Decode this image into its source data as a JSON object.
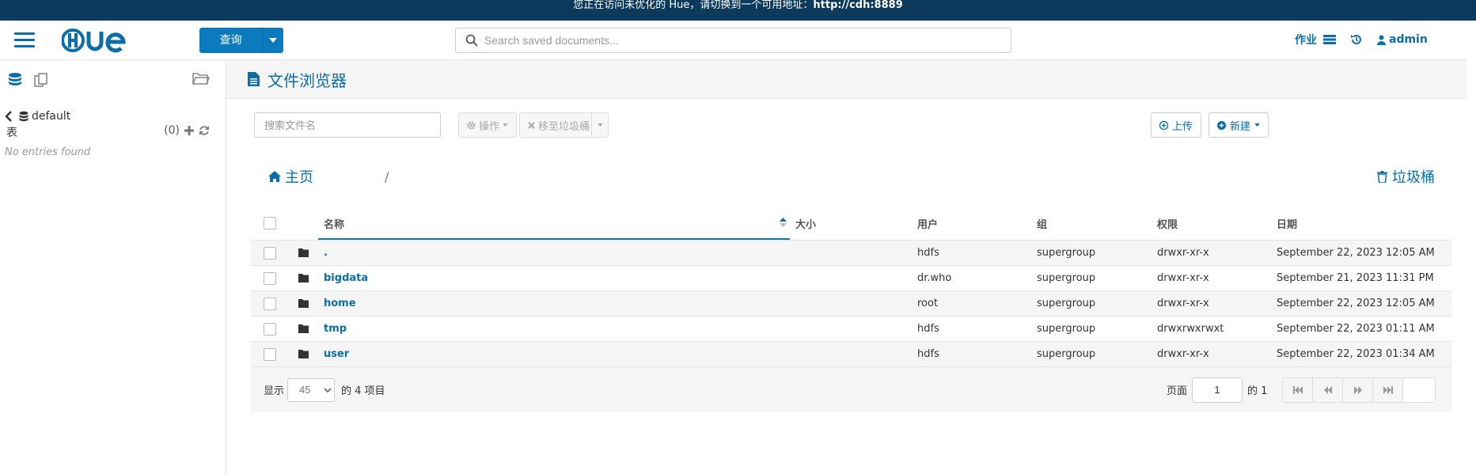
{
  "banner": {
    "text": "您正在访问未优化的 Hue，请切换到一个可用地址：",
    "link": "http://cdh:8889"
  },
  "topnav": {
    "logo": "Hue",
    "query_label": "查询",
    "search_placeholder": "Search saved documents...",
    "jobs_label": "作业",
    "user_label": "admin"
  },
  "sidebar": {
    "database": "default",
    "tables_label": "表",
    "tables_count": "(0)",
    "no_entries": "No entries found"
  },
  "main": {
    "title": "文件浏览器",
    "search_placeholder": "搜索文件名",
    "actions_label": "操作",
    "trash_move_label": "移至垃圾桶",
    "upload_label": "上传",
    "new_label": "新建",
    "breadcrumb_home": "主页",
    "breadcrumb_sep": "/",
    "trash_label": "垃圾桶"
  },
  "table": {
    "columns": [
      "名称",
      "大小",
      "用户",
      "组",
      "权限",
      "日期"
    ],
    "rows": [
      {
        "name": ".",
        "size": "",
        "user": "hdfs",
        "group": "supergroup",
        "perm": "drwxr-xr-x",
        "date": "September 22, 2023 12:05 AM"
      },
      {
        "name": "bigdata",
        "size": "",
        "user": "dr.who",
        "group": "supergroup",
        "perm": "drwxr-xr-x",
        "date": "September 21, 2023 11:31 PM"
      },
      {
        "name": "home",
        "size": "",
        "user": "root",
        "group": "supergroup",
        "perm": "drwxr-xr-x",
        "date": "September 22, 2023 12:05 AM"
      },
      {
        "name": "tmp",
        "size": "",
        "user": "hdfs",
        "group": "supergroup",
        "perm": "drwxrwxrwxt",
        "date": "September 22, 2023 01:11 AM"
      },
      {
        "name": "user",
        "size": "",
        "user": "hdfs",
        "group": "supergroup",
        "perm": "drwxr-xr-x",
        "date": "September 22, 2023 01:34 AM"
      }
    ]
  },
  "footer": {
    "show_label": "显示",
    "page_size": "45",
    "items_label": "的 4 项目",
    "page_label": "页面",
    "page_value": "1",
    "of_label": "的 1"
  },
  "colors": {
    "brand": "#0b6ea8",
    "banner": "#0b3a5c",
    "primary_button": "#0b7bbd"
  }
}
